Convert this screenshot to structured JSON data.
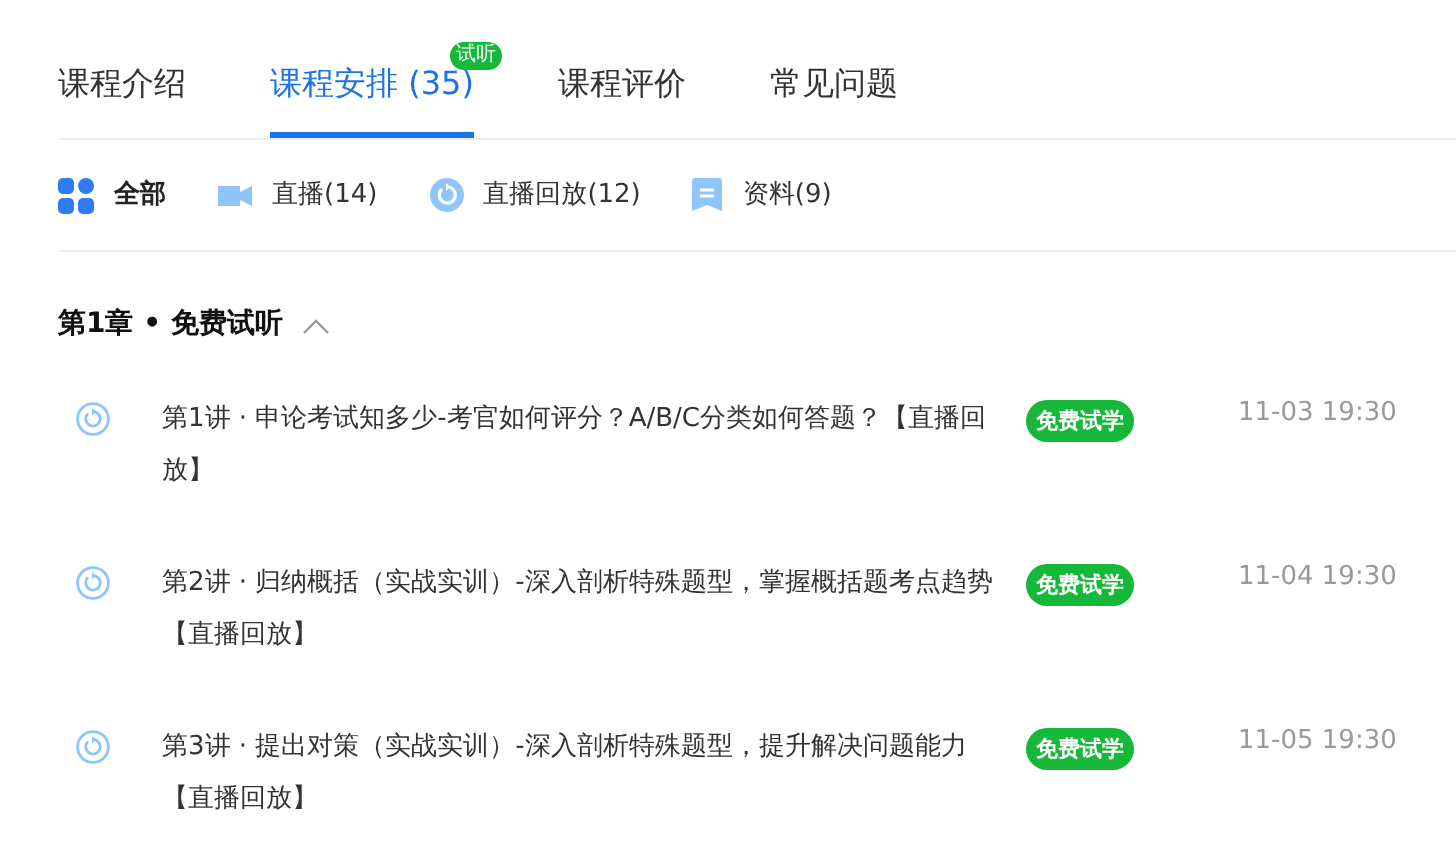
{
  "tabs": [
    {
      "label": "课程介绍",
      "selected": false
    },
    {
      "label": "课程安排 (35)",
      "selected": true,
      "badge": "试听"
    },
    {
      "label": "课程评价",
      "selected": false
    },
    {
      "label": "常见问题",
      "selected": false
    }
  ],
  "filters": [
    {
      "kind": "all",
      "label": "全部",
      "selected": true
    },
    {
      "kind": "live",
      "label": "直播(14)",
      "selected": false
    },
    {
      "kind": "replay",
      "label": "直播回放(12)",
      "selected": false
    },
    {
      "kind": "material",
      "label": "资料(9)",
      "selected": false
    }
  ],
  "chapter": {
    "title": "第1章 • 免费试听",
    "expanded": true
  },
  "lessons": [
    {
      "title": "第1讲 · 申论考试知多少-考官如何评分？A/B/C分类如何答题？【直播回放】",
      "tag": "免费试学",
      "time": "11-03 19:30"
    },
    {
      "title": "第2讲 · 归纳概括（实战实训）-深入剖析特殊题型，掌握概括题考点趋势【直播回放】",
      "tag": "免费试学",
      "time": "11-04 19:30"
    },
    {
      "title": "第3讲 · 提出对策（实战实训）-深入剖析特殊题型，提升解决问题能力【直播回放】",
      "tag": "免费试学",
      "time": "11-05 19:30"
    }
  ]
}
